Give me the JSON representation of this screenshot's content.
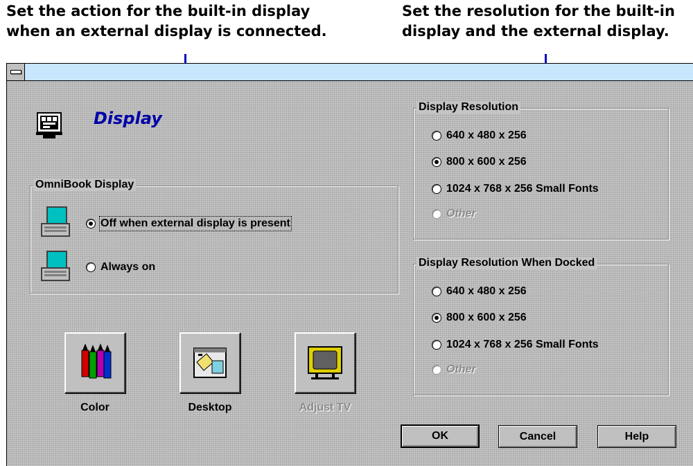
{
  "callouts": {
    "left": {
      "line1": "Set the action for the built-in display",
      "line2": "when an external display is connected."
    },
    "right": {
      "line1": "Set the resolution for the built-in",
      "line2": "display and the external display."
    }
  },
  "dialog": {
    "title": "Display",
    "omnibook_display": {
      "label": "OmniBook Display",
      "options": [
        {
          "label": "Off when external display is present",
          "accel": "O",
          "checked": true
        },
        {
          "label": "Always on",
          "accel": "A",
          "checked": false
        }
      ]
    },
    "display_resolution": {
      "label": "Display Resolution",
      "accel": "R",
      "options": [
        {
          "label": "640 x 480 x 256",
          "checked": false,
          "disabled": false
        },
        {
          "label": "800 x 600 x 256",
          "checked": true,
          "disabled": false
        },
        {
          "label": "1024 x 768 x 256 Small Fonts",
          "checked": false,
          "disabled": false
        },
        {
          "label": "Other",
          "checked": false,
          "disabled": true
        }
      ]
    },
    "docked_resolution": {
      "label": "Display Resolution When Docked",
      "accel": "D",
      "options": [
        {
          "label": "640 x 480 x 256",
          "checked": false,
          "disabled": false
        },
        {
          "label": "800 x 600 x 256",
          "checked": true,
          "disabled": false
        },
        {
          "label": "1024 x 768 x 256 Small Fonts",
          "checked": false,
          "disabled": false
        },
        {
          "label": "Other",
          "checked": false,
          "disabled": true
        }
      ]
    },
    "tools": [
      {
        "label": "Color",
        "icon": "crayons-icon",
        "disabled": false
      },
      {
        "label": "Desktop",
        "icon": "desktop-icon",
        "disabled": false
      },
      {
        "label": "Adjust TV",
        "icon": "tv-icon",
        "disabled": true
      }
    ],
    "buttons": {
      "ok": "OK",
      "cancel": "Cancel",
      "help": "Help"
    }
  },
  "colors": {
    "title_text": "#0000a8",
    "titlebar": "#c7e7ff",
    "callout_line": "#0000c8",
    "laptop_screen": "#00c0c0"
  }
}
